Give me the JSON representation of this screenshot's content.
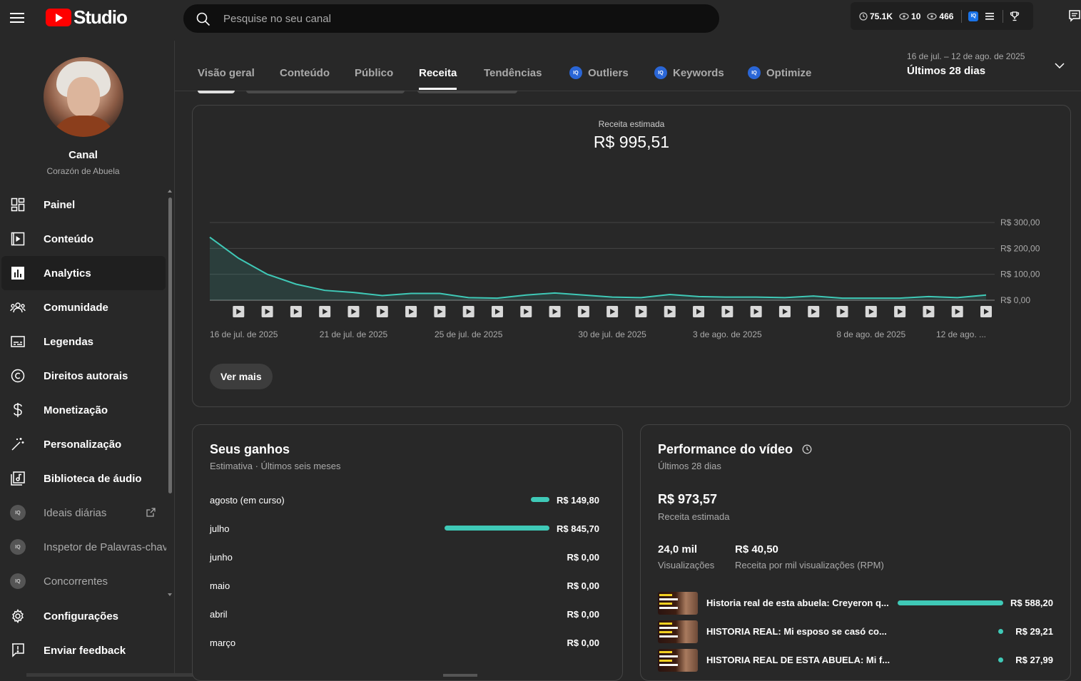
{
  "app": {
    "logo_text": "Studio"
  },
  "search": {
    "placeholder": "Pesquise no seu canal"
  },
  "stats": {
    "watch_time": "75.1K",
    "viewers": "10",
    "views": "466",
    "iq_label": "IQ"
  },
  "channel": {
    "label": "Canal",
    "name": "Corazón de Abuela"
  },
  "sidebar": {
    "items": [
      {
        "label": "Painel",
        "icon": "dashboard-icon"
      },
      {
        "label": "Conteúdo",
        "icon": "content-icon"
      },
      {
        "label": "Analytics",
        "icon": "analytics-icon",
        "active": true
      },
      {
        "label": "Comunidade",
        "icon": "community-icon"
      },
      {
        "label": "Legendas",
        "icon": "subtitles-icon"
      },
      {
        "label": "Direitos autorais",
        "icon": "copyright-icon"
      },
      {
        "label": "Monetização",
        "icon": "dollar-icon"
      },
      {
        "label": "Personalização",
        "icon": "magic-wand-icon"
      },
      {
        "label": "Biblioteca de áudio",
        "icon": "audio-library-icon"
      },
      {
        "label": "Ideais diárias",
        "icon": "iq-icon"
      },
      {
        "label": "Inspetor de Palavras-chav",
        "icon": "iq-icon"
      },
      {
        "label": "Concorrentes",
        "icon": "iq-icon"
      },
      {
        "label": "Configurações",
        "icon": "gear-icon"
      },
      {
        "label": "Enviar feedback",
        "icon": "feedback-icon"
      }
    ]
  },
  "tabs": [
    {
      "label": "Visão geral"
    },
    {
      "label": "Conteúdo"
    },
    {
      "label": "Público"
    },
    {
      "label": "Receita",
      "active": true
    },
    {
      "label": "Tendências"
    },
    {
      "label": "Outliers",
      "iq": true
    },
    {
      "label": "Keywords",
      "iq": true
    },
    {
      "label": "Optimize",
      "iq": true
    }
  ],
  "date_range": {
    "sub": "16 de jul. – 12 de ago. de 2025",
    "main": "Últimos 28 dias"
  },
  "revenue_card": {
    "title": "Receita estimada",
    "total": "R$ 995,51",
    "more_button": "Ver mais"
  },
  "chart_data": {
    "type": "area",
    "title": "Receita estimada",
    "ylim": [
      0,
      300
    ],
    "y_ticks": [
      "R$ 0,00",
      "R$ 100,00",
      "R$ 200,00",
      "R$ 300,00"
    ],
    "y_tick_values": [
      0,
      100,
      200,
      300
    ],
    "x_tick_labels": [
      "16 de jul. de 2025",
      "21 de jul. de 2025",
      "25 de jul. de 2025",
      "30 de jul. de 2025",
      "3 de ago. de 2025",
      "8 de ago. de 2025",
      "12 de ago. ..."
    ],
    "x_tick_indices": [
      0,
      5,
      9,
      14,
      18,
      23,
      27
    ],
    "series": [
      {
        "values": [
          243,
          162,
          100,
          62,
          38,
          30,
          18,
          26,
          26,
          10,
          8,
          20,
          28,
          20,
          12,
          10,
          22,
          14,
          12,
          12,
          10,
          16,
          8,
          8,
          8,
          14,
          10,
          20
        ]
      }
    ],
    "color": "#3fc9b7",
    "grid": true
  },
  "earnings": {
    "title": "Seus ganhos",
    "subtitle": "Estimativa · Últimos seis meses",
    "rows": [
      {
        "month": "agosto (em curso)",
        "value": "R$ 149,80",
        "amount": 149.8
      },
      {
        "month": "julho",
        "value": "R$ 845,70",
        "amount": 845.7
      },
      {
        "month": "junho",
        "value": "R$ 0,00",
        "amount": 0
      },
      {
        "month": "maio",
        "value": "R$ 0,00",
        "amount": 0
      },
      {
        "month": "abril",
        "value": "R$ 0,00",
        "amount": 0
      },
      {
        "month": "março",
        "value": "R$ 0,00",
        "amount": 0
      }
    ]
  },
  "performance": {
    "title": "Performance do vídeo",
    "subtitle": "Últimos 28 dias",
    "total": "R$ 973,57",
    "total_label": "Receita estimada",
    "views": "24,0 mil",
    "views_label": "Visualizações",
    "rpm": "R$ 40,50",
    "rpm_label": "Receita por mil visualizações (RPM)",
    "videos": [
      {
        "title": "Historia real de esta abuela: Creyeron q...",
        "value": "R$ 588,20",
        "amount": 588.2
      },
      {
        "title": "HISTORIA REAL: Mi esposo se casó co...",
        "value": "R$ 29,21",
        "amount": 29.21
      },
      {
        "title": "HISTORIA REAL DE ESTA ABUELA: Mi f...",
        "value": "R$ 27,99",
        "amount": 27.99
      }
    ]
  },
  "colors": {
    "accent": "#3fc9b7",
    "brand": "#ff0000",
    "iq": "#1a73e8"
  }
}
